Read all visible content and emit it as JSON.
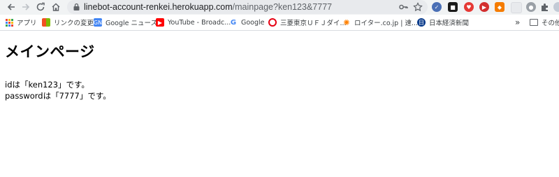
{
  "browser": {
    "url_host": "linebot-account-renkei.herokuapp.com",
    "url_path": "/mainpage?ken123&7777"
  },
  "bookmarks": {
    "items": [
      {
        "label": "アプリ"
      },
      {
        "label": "リンクの変更"
      },
      {
        "label": "Google ニュース"
      },
      {
        "label": "YouTube - Broadc..."
      },
      {
        "label": "Google"
      },
      {
        "label": "三菱東京ＵＦＪダイ..."
      },
      {
        "label": "ロイター.co.jp | 速..."
      },
      {
        "label": "日本経済新聞"
      }
    ],
    "overflow": "»",
    "other": "その他の"
  },
  "page": {
    "heading": "メインページ",
    "id_line": "idは「ken123」です。",
    "password_line": "passwordは「7777」です。"
  }
}
